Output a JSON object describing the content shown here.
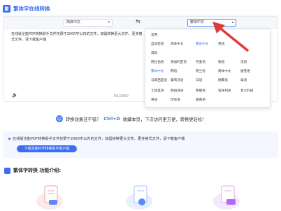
{
  "header": {
    "title": "繁体字在线转换"
  },
  "converter": {
    "source_lang": "简体中文",
    "target_lang": "繁体中文",
    "source_text": "在线就全能PDF转换助手文件仅限于2000字以内的文件，如需转换更大文件，更多格式文件，请下载客户端",
    "counter": "50/2000"
  },
  "dropdown": {
    "items": [
      [
        "常用"
      ],
      [
        "自动检测",
        "简体中文",
        "繁体中文",
        "英语"
      ],
      [
        "其他"
      ],
      [
        "阿拉伯语",
        "保加利亚语",
        "丹麦语",
        "德语",
        "法语"
      ],
      [
        "繁体中文",
        "韩语",
        "荷兰语",
        "简体中文",
        "捷克语"
      ],
      [
        "马来西亚语",
        "葡萄牙语",
        "日语",
        "瑞典语",
        "泰语"
      ],
      [
        "土耳其语",
        "西班牙语",
        "希腊语",
        "匈牙利语",
        "意大利语"
      ],
      [
        "英语",
        "印尼语",
        "越南语"
      ]
    ],
    "active": "繁体中文"
  },
  "feedback": {
    "text_before": "转换效果还不错？",
    "shortcut": "Ctrl+D",
    "text_after": "收藏本页，下次访问更方便，转换更轻松！"
  },
  "promo": {
    "text": "在线版全能PDF转换助手文件仅限于2000字以内的文件，如需转换更大文件、更多格式文件，请下载客户端",
    "button": "下载全能PDF转换助手客户端"
  },
  "features": {
    "title": "繁体字转换 功能介绍:"
  },
  "colors": {
    "accent": "#3b6ef5",
    "arrow": "#e53935"
  }
}
